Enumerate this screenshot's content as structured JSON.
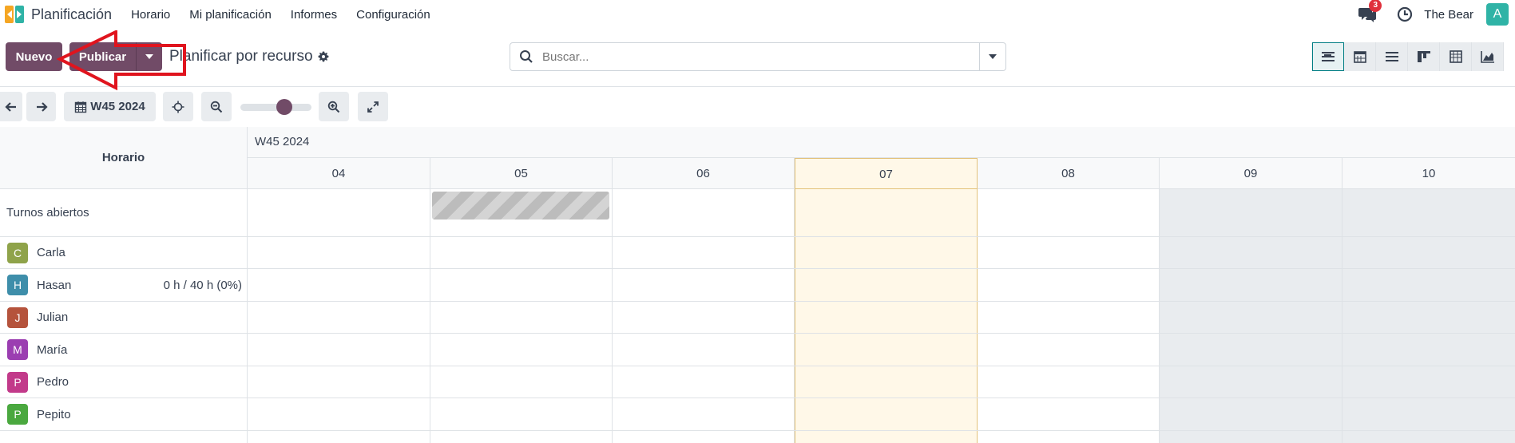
{
  "navbar": {
    "app_name": "Planificación",
    "menu": [
      "Horario",
      "Mi planificación",
      "Informes",
      "Configuración"
    ],
    "chat_badge": "3",
    "company": "The Bear",
    "user_initial": "A"
  },
  "control_panel": {
    "new_label": "Nuevo",
    "publish_label": "Publicar",
    "breadcrumb": "Planificar por recurso",
    "search_placeholder": "Buscar...",
    "views": [
      "gantt-view-icon",
      "calendar-view-icon",
      "list-view-icon",
      "kanban-view-icon",
      "pivot-view-icon",
      "graph-view-icon"
    ],
    "active_view": "gantt-view-icon"
  },
  "toolbar": {
    "week_label": "W45 2024",
    "zoom_level": 0.65
  },
  "gantt": {
    "group_header": "Horario",
    "week_header": "W45 2024",
    "days": [
      "04",
      "05",
      "06",
      "07",
      "08",
      "09",
      "10"
    ],
    "today": "07",
    "weekend_days": [
      "09",
      "10"
    ],
    "open_shifts_label": "Turnos abiertos",
    "open_shift_day": "05",
    "resources": [
      {
        "initial": "C",
        "name": "Carla",
        "hours": "",
        "color": "#8fa34a"
      },
      {
        "initial": "H",
        "name": "Hasan",
        "hours": "0 h / 40 h (0%)",
        "color": "#3e8eaa"
      },
      {
        "initial": "J",
        "name": "Julian",
        "hours": "",
        "color": "#b5533c"
      },
      {
        "initial": "M",
        "name": "María",
        "hours": "",
        "color": "#9b3eb1"
      },
      {
        "initial": "P",
        "name": "Pedro",
        "hours": "",
        "color": "#c23a8a"
      },
      {
        "initial": "P",
        "name": "Pepito",
        "hours": "",
        "color": "#4aa83f"
      }
    ]
  },
  "colors": {
    "primary": "#714b67",
    "accent": "#017e84",
    "today_bg": "#fff8e8",
    "weekend_bg": "#e9ecef",
    "annotation_arrow": "#e0141e"
  }
}
